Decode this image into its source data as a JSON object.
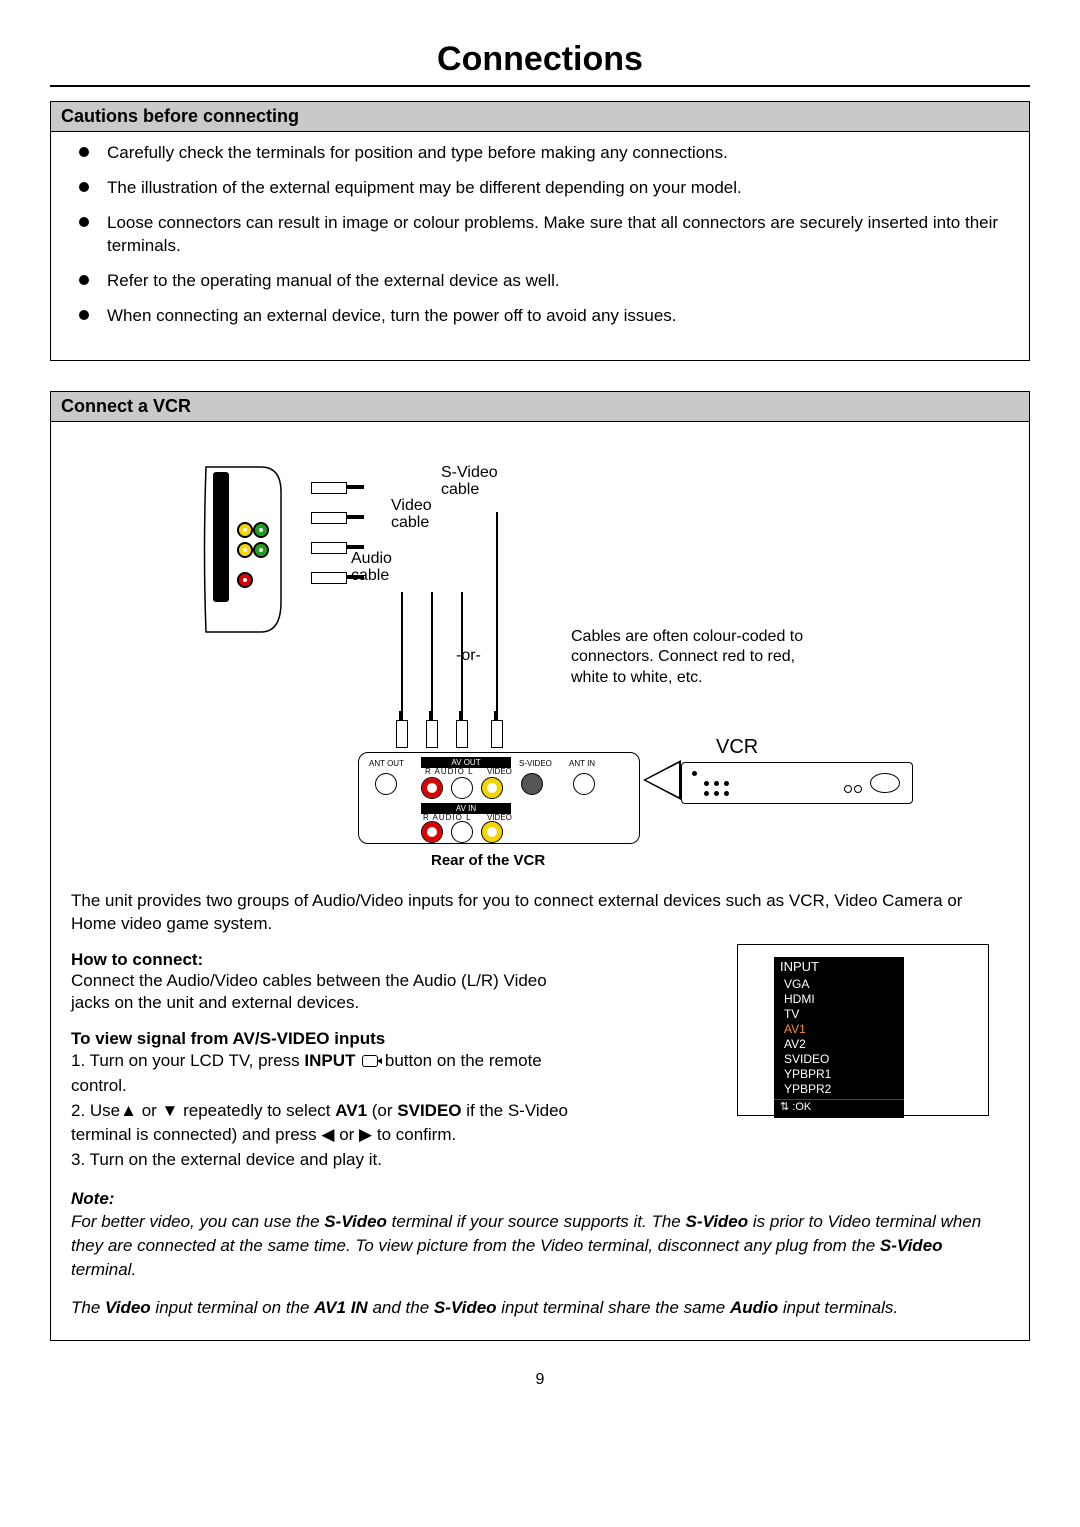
{
  "page_title": "Connections",
  "page_number": "9",
  "cautions": {
    "header": "Cautions before connecting",
    "items": [
      "Carefully check the terminals for position and type before making any connections.",
      "The illustration of the external equipment may be different depending on your model.",
      "Loose connectors can result in image or colour problems. Make sure that all connectors are securely inserted into their terminals.",
      "Refer to the operating manual of the external device as well.",
      "When connecting an external device, turn the power off to avoid any issues."
    ]
  },
  "vcr": {
    "header": "Connect a VCR",
    "labels": {
      "svideo": "S-Video cable",
      "video": "Video cable",
      "audio": "Audio cable",
      "or": "-or-",
      "note": "Cables are often colour-coded to connectors. Connect red to red, white to white, etc.",
      "vcr": "VCR",
      "rear": "Rear of the VCR",
      "ant_out": "ANT OUT",
      "ant_in": "ANT IN",
      "av_out": "AV OUT",
      "av_in": "AV IN",
      "s_video": "S-VIDEO",
      "audio_rl": "R  AUDIO  L",
      "video_lbl": "VIDEO"
    },
    "intro": "The unit provides two groups of Audio/Video inputs for you to connect external devices such as VCR, Video Camera or Home video game system.",
    "how_head": "How to connect:",
    "how_text": "Connect the Audio/Video cables between the Audio (L/R) Video jacks on the unit and external devices.",
    "view_head": "To view signal from AV/S-VIDEO inputs",
    "steps": {
      "s1a": "1. Turn on your LCD TV, press ",
      "s1b": "INPUT",
      "s1c": " button on the remote control.",
      "s2a": "2. Use",
      "s2b": " or ",
      "s2c": " repeatedly to select ",
      "s2d": "AV1",
      "s2e": " (or ",
      "s2f": "SVIDEO",
      "s2g": " if the S-Video terminal is connected) and press ",
      "s2h": " or ",
      "s2i": " to confirm.",
      "s3": "3. Turn on the external device and play it."
    },
    "note_head": "Note:",
    "note1a": "For better video, you can use the ",
    "note1b": "S-Video",
    "note1c": " terminal if your source supports it. The ",
    "note1d": "S-Video",
    "note1e": " is prior to Video terminal when they are connected at the same time. To view picture from the Video terminal, disconnect any plug from the ",
    "note1f": "S-Video",
    "note1g": " terminal.",
    "note2a": "The ",
    "note2b": "Video",
    "note2c": " input terminal on the ",
    "note2d": "AV1 IN",
    "note2e": " and the ",
    "note2f": "S-Video",
    "note2g": " input terminal share the same ",
    "note2h": "Audio",
    "note2i": " input terminals."
  },
  "input_menu": {
    "title": "INPUT",
    "items": [
      "VGA",
      "HDMI",
      "TV",
      "AV1",
      "AV2",
      "SVIDEO",
      "YPBPR1",
      "YPBPR2"
    ],
    "selected_index": 3,
    "ok": ":OK"
  }
}
